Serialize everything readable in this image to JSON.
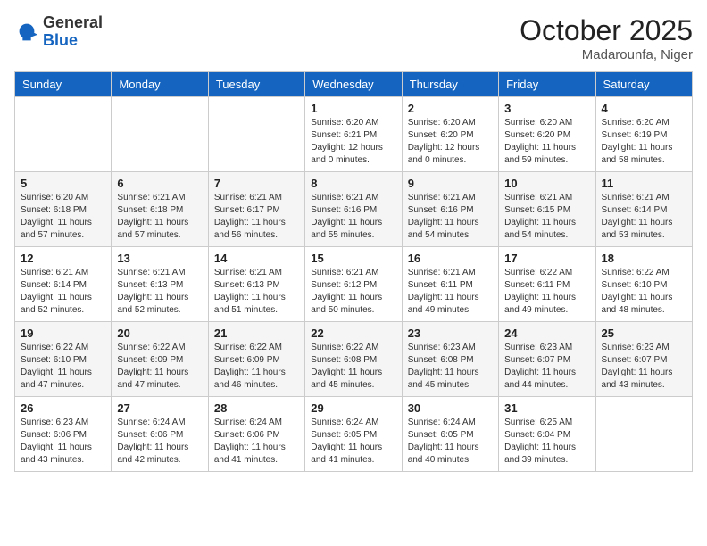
{
  "header": {
    "logo_general": "General",
    "logo_blue": "Blue",
    "month_title": "October 2025",
    "location": "Madarounfa, Niger"
  },
  "days_of_week": [
    "Sunday",
    "Monday",
    "Tuesday",
    "Wednesday",
    "Thursday",
    "Friday",
    "Saturday"
  ],
  "weeks": [
    [
      {
        "day": "",
        "info": ""
      },
      {
        "day": "",
        "info": ""
      },
      {
        "day": "",
        "info": ""
      },
      {
        "day": "1",
        "info": "Sunrise: 6:20 AM\nSunset: 6:21 PM\nDaylight: 12 hours\nand 0 minutes."
      },
      {
        "day": "2",
        "info": "Sunrise: 6:20 AM\nSunset: 6:20 PM\nDaylight: 12 hours\nand 0 minutes."
      },
      {
        "day": "3",
        "info": "Sunrise: 6:20 AM\nSunset: 6:20 PM\nDaylight: 11 hours\nand 59 minutes."
      },
      {
        "day": "4",
        "info": "Sunrise: 6:20 AM\nSunset: 6:19 PM\nDaylight: 11 hours\nand 58 minutes."
      }
    ],
    [
      {
        "day": "5",
        "info": "Sunrise: 6:20 AM\nSunset: 6:18 PM\nDaylight: 11 hours\nand 57 minutes."
      },
      {
        "day": "6",
        "info": "Sunrise: 6:21 AM\nSunset: 6:18 PM\nDaylight: 11 hours\nand 57 minutes."
      },
      {
        "day": "7",
        "info": "Sunrise: 6:21 AM\nSunset: 6:17 PM\nDaylight: 11 hours\nand 56 minutes."
      },
      {
        "day": "8",
        "info": "Sunrise: 6:21 AM\nSunset: 6:16 PM\nDaylight: 11 hours\nand 55 minutes."
      },
      {
        "day": "9",
        "info": "Sunrise: 6:21 AM\nSunset: 6:16 PM\nDaylight: 11 hours\nand 54 minutes."
      },
      {
        "day": "10",
        "info": "Sunrise: 6:21 AM\nSunset: 6:15 PM\nDaylight: 11 hours\nand 54 minutes."
      },
      {
        "day": "11",
        "info": "Sunrise: 6:21 AM\nSunset: 6:14 PM\nDaylight: 11 hours\nand 53 minutes."
      }
    ],
    [
      {
        "day": "12",
        "info": "Sunrise: 6:21 AM\nSunset: 6:14 PM\nDaylight: 11 hours\nand 52 minutes."
      },
      {
        "day": "13",
        "info": "Sunrise: 6:21 AM\nSunset: 6:13 PM\nDaylight: 11 hours\nand 52 minutes."
      },
      {
        "day": "14",
        "info": "Sunrise: 6:21 AM\nSunset: 6:13 PM\nDaylight: 11 hours\nand 51 minutes."
      },
      {
        "day": "15",
        "info": "Sunrise: 6:21 AM\nSunset: 6:12 PM\nDaylight: 11 hours\nand 50 minutes."
      },
      {
        "day": "16",
        "info": "Sunrise: 6:21 AM\nSunset: 6:11 PM\nDaylight: 11 hours\nand 49 minutes."
      },
      {
        "day": "17",
        "info": "Sunrise: 6:22 AM\nSunset: 6:11 PM\nDaylight: 11 hours\nand 49 minutes."
      },
      {
        "day": "18",
        "info": "Sunrise: 6:22 AM\nSunset: 6:10 PM\nDaylight: 11 hours\nand 48 minutes."
      }
    ],
    [
      {
        "day": "19",
        "info": "Sunrise: 6:22 AM\nSunset: 6:10 PM\nDaylight: 11 hours\nand 47 minutes."
      },
      {
        "day": "20",
        "info": "Sunrise: 6:22 AM\nSunset: 6:09 PM\nDaylight: 11 hours\nand 47 minutes."
      },
      {
        "day": "21",
        "info": "Sunrise: 6:22 AM\nSunset: 6:09 PM\nDaylight: 11 hours\nand 46 minutes."
      },
      {
        "day": "22",
        "info": "Sunrise: 6:22 AM\nSunset: 6:08 PM\nDaylight: 11 hours\nand 45 minutes."
      },
      {
        "day": "23",
        "info": "Sunrise: 6:23 AM\nSunset: 6:08 PM\nDaylight: 11 hours\nand 45 minutes."
      },
      {
        "day": "24",
        "info": "Sunrise: 6:23 AM\nSunset: 6:07 PM\nDaylight: 11 hours\nand 44 minutes."
      },
      {
        "day": "25",
        "info": "Sunrise: 6:23 AM\nSunset: 6:07 PM\nDaylight: 11 hours\nand 43 minutes."
      }
    ],
    [
      {
        "day": "26",
        "info": "Sunrise: 6:23 AM\nSunset: 6:06 PM\nDaylight: 11 hours\nand 43 minutes."
      },
      {
        "day": "27",
        "info": "Sunrise: 6:24 AM\nSunset: 6:06 PM\nDaylight: 11 hours\nand 42 minutes."
      },
      {
        "day": "28",
        "info": "Sunrise: 6:24 AM\nSunset: 6:06 PM\nDaylight: 11 hours\nand 41 minutes."
      },
      {
        "day": "29",
        "info": "Sunrise: 6:24 AM\nSunset: 6:05 PM\nDaylight: 11 hours\nand 41 minutes."
      },
      {
        "day": "30",
        "info": "Sunrise: 6:24 AM\nSunset: 6:05 PM\nDaylight: 11 hours\nand 40 minutes."
      },
      {
        "day": "31",
        "info": "Sunrise: 6:25 AM\nSunset: 6:04 PM\nDaylight: 11 hours\nand 39 minutes."
      },
      {
        "day": "",
        "info": ""
      }
    ]
  ]
}
